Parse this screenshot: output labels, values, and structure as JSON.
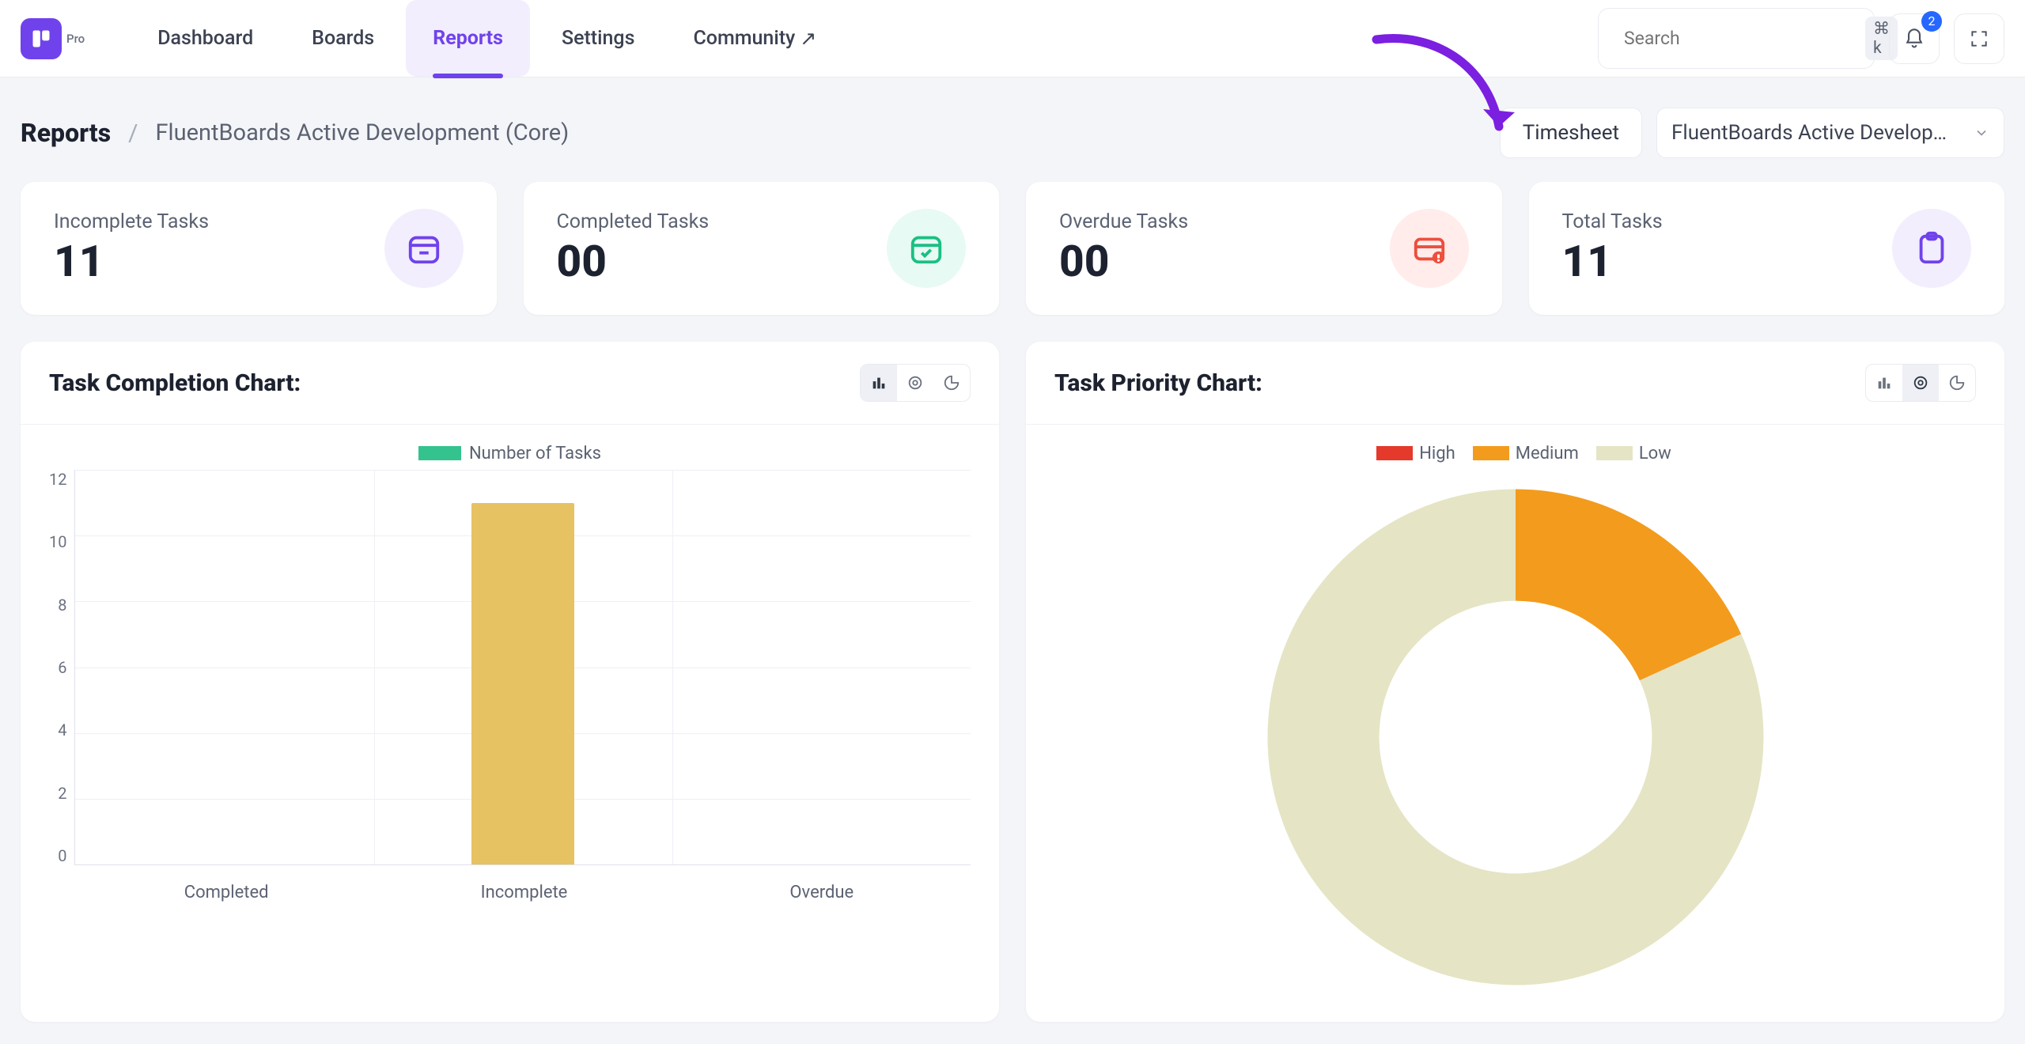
{
  "logo_tag": "Pro",
  "nav": {
    "items": [
      {
        "id": "dashboard",
        "label": "Dashboard"
      },
      {
        "id": "boards",
        "label": "Boards"
      },
      {
        "id": "reports",
        "label": "Reports"
      },
      {
        "id": "settings",
        "label": "Settings"
      },
      {
        "id": "community",
        "label": "Community",
        "external": true
      }
    ],
    "active": "reports"
  },
  "search": {
    "placeholder": "Search",
    "shortcut": "⌘ k",
    "value": ""
  },
  "notifications": {
    "count": 2
  },
  "breadcrumb": {
    "root": "Reports",
    "leaf": "FluentBoards Active Development (Core)"
  },
  "subhead": {
    "timesheet_label": "Timesheet",
    "board_select": "FluentBoards Active Develop…"
  },
  "cards": [
    {
      "id": "incomplete",
      "label": "Incomplete Tasks",
      "value": "11",
      "icon": "calendar-minus",
      "tone": "purple"
    },
    {
      "id": "completed",
      "label": "Completed Tasks",
      "value": "00",
      "icon": "calendar-check",
      "tone": "green"
    },
    {
      "id": "overdue",
      "label": "Overdue Tasks",
      "value": "00",
      "icon": "card-alert",
      "tone": "red"
    },
    {
      "id": "total",
      "label": "Total Tasks",
      "value": "11",
      "icon": "clipboard",
      "tone": "purple"
    }
  ],
  "chart_left": {
    "title": "Task Completion Chart:",
    "legend": "Number of Tasks",
    "legend_color": "#34c38f"
  },
  "chart_right": {
    "title": "Task Priority Chart:"
  },
  "chart_data": [
    {
      "id": "task_completion",
      "type": "bar",
      "title": "Task Completion Chart",
      "xlabel": "",
      "ylabel": "Number of Tasks",
      "categories": [
        "Completed",
        "Incomplete",
        "Overdue"
      ],
      "values": [
        0,
        11,
        0
      ],
      "ylim": [
        0,
        12
      ],
      "yticks": [
        0,
        2,
        4,
        6,
        8,
        10,
        12
      ],
      "bar_color": "#e7c263",
      "series_name": "Number of Tasks"
    },
    {
      "id": "task_priority",
      "type": "pie",
      "subtype": "donut",
      "title": "Task Priority Chart",
      "series": [
        {
          "name": "High",
          "value": 0,
          "color": "#e4392b"
        },
        {
          "name": "Medium",
          "value": 2,
          "color": "#f39b1d"
        },
        {
          "name": "Low",
          "value": 9,
          "color": "#e5e4c4"
        }
      ],
      "inner_radius_ratio": 0.55
    }
  ]
}
